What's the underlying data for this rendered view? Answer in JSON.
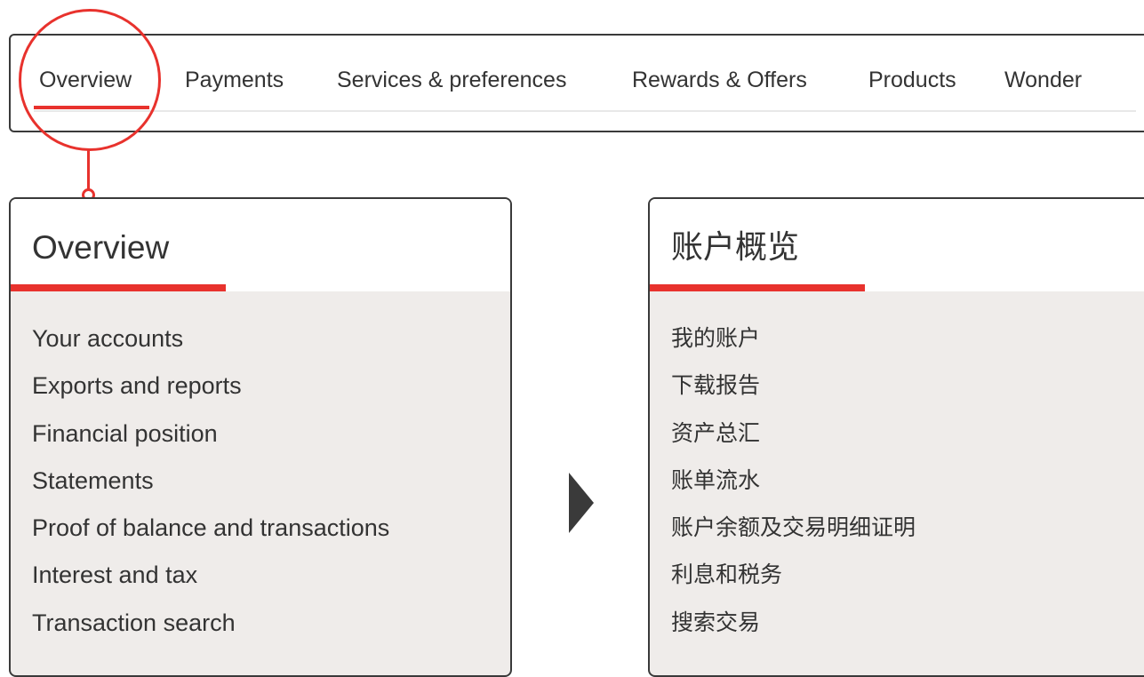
{
  "nav": {
    "items": [
      {
        "label": "Overview",
        "active": true
      },
      {
        "label": "Payments",
        "active": false
      },
      {
        "label": "Services & preferences",
        "active": false
      },
      {
        "label": "Rewards & Offers",
        "active": false
      },
      {
        "label": "Products",
        "active": false
      },
      {
        "label": "Wonder",
        "active": false
      }
    ]
  },
  "menu_en": {
    "title": "Overview",
    "items": [
      "Your accounts",
      "Exports and reports",
      "Financial position",
      "Statements",
      "Proof of balance and transactions",
      "Interest and tax",
      "Transaction search"
    ]
  },
  "menu_zh": {
    "title": "账户概览",
    "items": [
      "我的账户",
      "下载报告",
      "资产总汇",
      "账单流水",
      "账户余额及交易明细证明",
      "利息和税务",
      "搜索交易"
    ]
  },
  "colors": {
    "accent": "#e8322d",
    "border": "#3a3a3a",
    "panel_bg": "#efecea",
    "text": "#333333"
  },
  "icons": {
    "arrow": "play-arrow-icon"
  }
}
